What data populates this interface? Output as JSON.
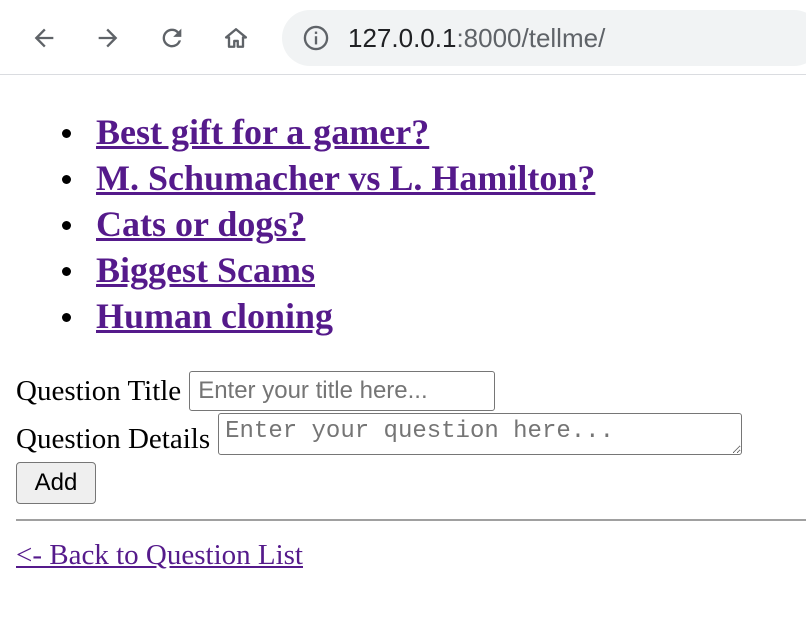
{
  "browser": {
    "url_host": "127.0.0.1",
    "url_rest": ":8000/tellme/"
  },
  "questions": [
    {
      "label": "Best gift for a gamer?"
    },
    {
      "label": "M. Schumacher vs L. Hamilton?"
    },
    {
      "label": "Cats or dogs?"
    },
    {
      "label": "Biggest Scams"
    },
    {
      "label": "Human cloning"
    }
  ],
  "form": {
    "title_label": "Question Title",
    "title_placeholder": "Enter your title here...",
    "title_value": "",
    "details_label": "Question Details",
    "details_placeholder": "Enter your question here...",
    "details_value": "",
    "add_label": "Add"
  },
  "back_link": "<- Back to Question List",
  "colors": {
    "visited_link": "#551a8b",
    "omnibox_bg": "#f1f3f4"
  }
}
